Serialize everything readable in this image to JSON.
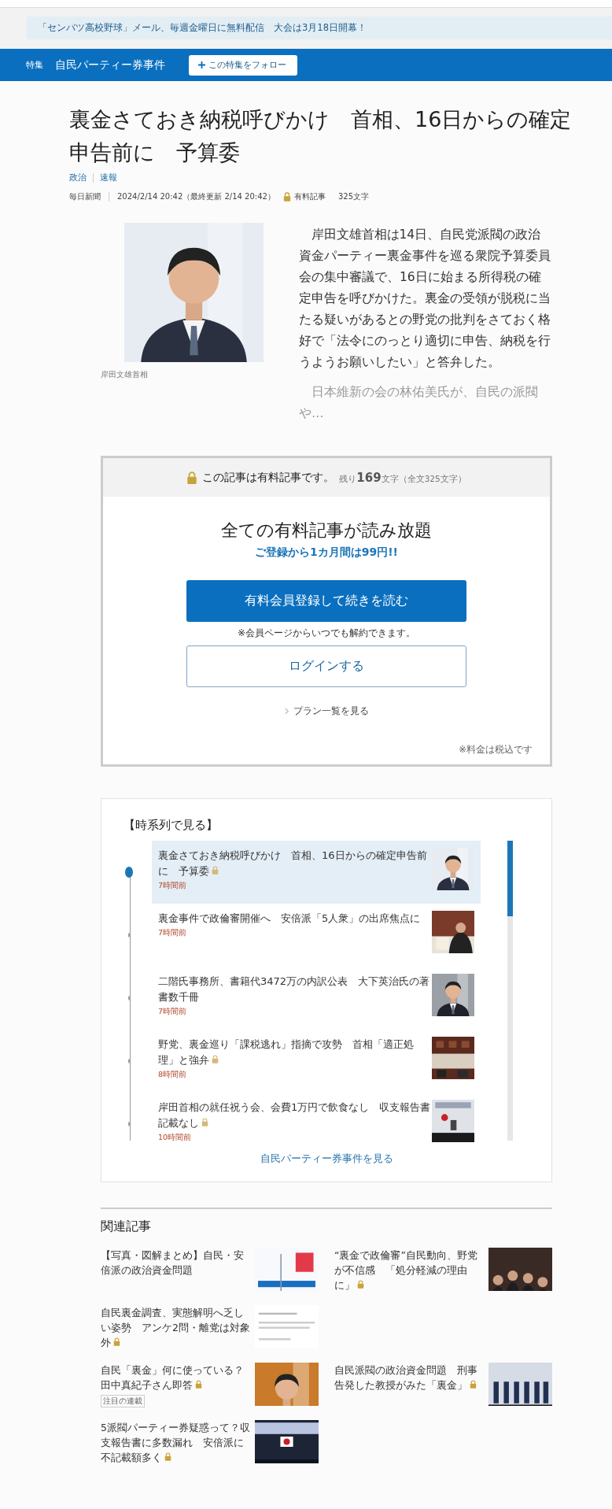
{
  "notice": "「センバツ高校野球」メール、毎週金曜日に無料配信　大会は3月18日開幕！",
  "feature_bar": {
    "label": "特集",
    "name": "自民パーティー券事件",
    "follow_button": "この特集をフォロー"
  },
  "article": {
    "title": "裏金さておき納税呼びかけ　首相、16日からの確定申告前に　予算委",
    "categories": [
      "政治",
      "速報"
    ],
    "source": "毎日新聞",
    "date": "2024/2/14 20:42（最終更新 2/14 20:42）",
    "paid": true,
    "paid_label": "有料記事",
    "length": "325文字",
    "photo": {
      "kind": "picture",
      "caption": "岸田文雄首相"
    },
    "paragraphs": [
      {
        "text": "岸田文雄首相は14日、自民党派閥の政治資金パーティー裏金事件を巡る衆院予算委員会の集中審議で、16日に始まる所得税の確定申告を呼びかけた。裏金の受領が脱税に当たる疑いがあるとの野党の批判をさておく格好で「法令にのっとり適切に申告、納税を行うようお願いしたい」と答弁した。",
        "faded": false
      },
      {
        "text": "日本維新の会の林佑美氏が、自民の派閥や…",
        "faded": true
      }
    ]
  },
  "paywall": {
    "notice": "この記事は有料記事です。",
    "remaining": "残り**169**文字（全文325文字）",
    "headline": "全ての有料記事が読み放題",
    "offer": "ご登録から1カ月間は99円!!",
    "register_button": "有料会員登録して続きを読む",
    "cancel_note": "※会員ページからいつでも解約できます。",
    "login_button": "ログインする",
    "plans_link": "プラン一覧を見る",
    "tax_note": "※料金は税込です"
  },
  "timeline": {
    "heading": "【時系列で見る】",
    "more_link": "自民パーティー券事件を見る",
    "items": [
      {
        "title": "裏金さておき納税呼びかけ　首相、16日からの確定申告前に　予算委",
        "time": "7時間前",
        "paid": true,
        "selected": true
      },
      {
        "title": "裏金事件で政倫審開催へ　安倍派「5人衆」の出席焦点に",
        "time": "7時間前",
        "paid": false,
        "selected": false
      },
      {
        "title": "二階氏事務所、書籍代3472万の内訳公表　大下英治氏の著書数千冊",
        "time": "7時間前",
        "paid": false,
        "selected": false
      },
      {
        "title": "野党、裏金巡り「課税逃れ」指摘で攻勢　首相「適正処理」と強弁",
        "time": "8時間前",
        "paid": true,
        "selected": false
      },
      {
        "title": "岸田首相の就任祝う会、会費1万円で飲食なし　収支報告書記載なし",
        "time": "10時間前",
        "paid": true,
        "selected": false
      }
    ]
  },
  "related": {
    "heading": "関連記事",
    "rows": [
      [
        {
          "title": "【写真・図解まとめ】自民・安倍派の政治資金問題",
          "paid": false
        },
        {
          "title": "“裏金で政倫審”自民動向、野党が不信感　「処分軽減の理由に」",
          "paid": true
        }
      ],
      [
        {
          "title": "自民裏金調査、実態解明へ乏しい姿勢　アンケ2問・離党は対象外",
          "paid": true
        }
      ],
      [
        {
          "title": "自民「裏金」何に使っている？田中真紀子さん即答",
          "paid": true,
          "tag": "注目の連載"
        },
        {
          "title": "自民派閥の政治資金問題　刑事告発した教授がみた「裏金」",
          "paid": true
        }
      ],
      [
        {
          "title": "5派閥パーティー券疑惑って？収支報告書に多数漏れ　安倍派に不記載額多く",
          "paid": true
        }
      ]
    ]
  }
}
